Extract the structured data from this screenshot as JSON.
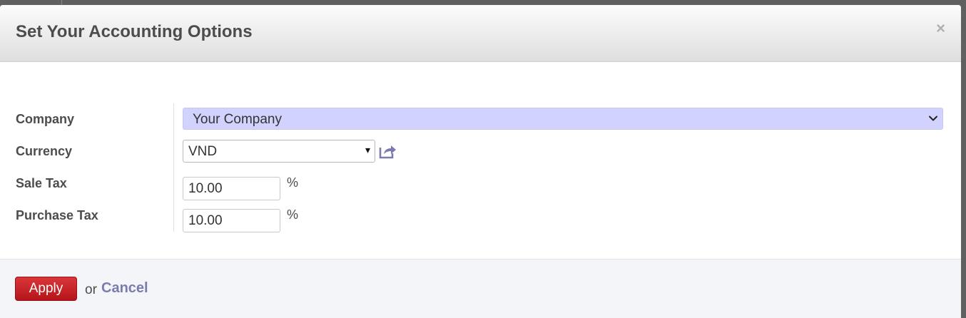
{
  "dialog": {
    "title": "Set Your Accounting Options",
    "close_icon": "×"
  },
  "form": {
    "company": {
      "label": "Company",
      "value": "Your Company"
    },
    "currency": {
      "label": "Currency",
      "value": "VND",
      "dropdown_icon": "▾"
    },
    "sale_tax": {
      "label": "Sale Tax",
      "value": "10.00",
      "unit": "%"
    },
    "purchase_tax": {
      "label": "Purchase Tax",
      "value": "10.00",
      "unit": "%"
    }
  },
  "footer": {
    "apply_label": "Apply",
    "or_text": "or",
    "cancel_label": "Cancel"
  },
  "colors": {
    "primary_button": "#c9262b",
    "link": "#7c7bad",
    "company_field_bg": "#d2d2ff"
  },
  "icons": {
    "external_link": "external-link-icon",
    "select_chevron": "chevron-down-icon",
    "close": "close-icon"
  }
}
